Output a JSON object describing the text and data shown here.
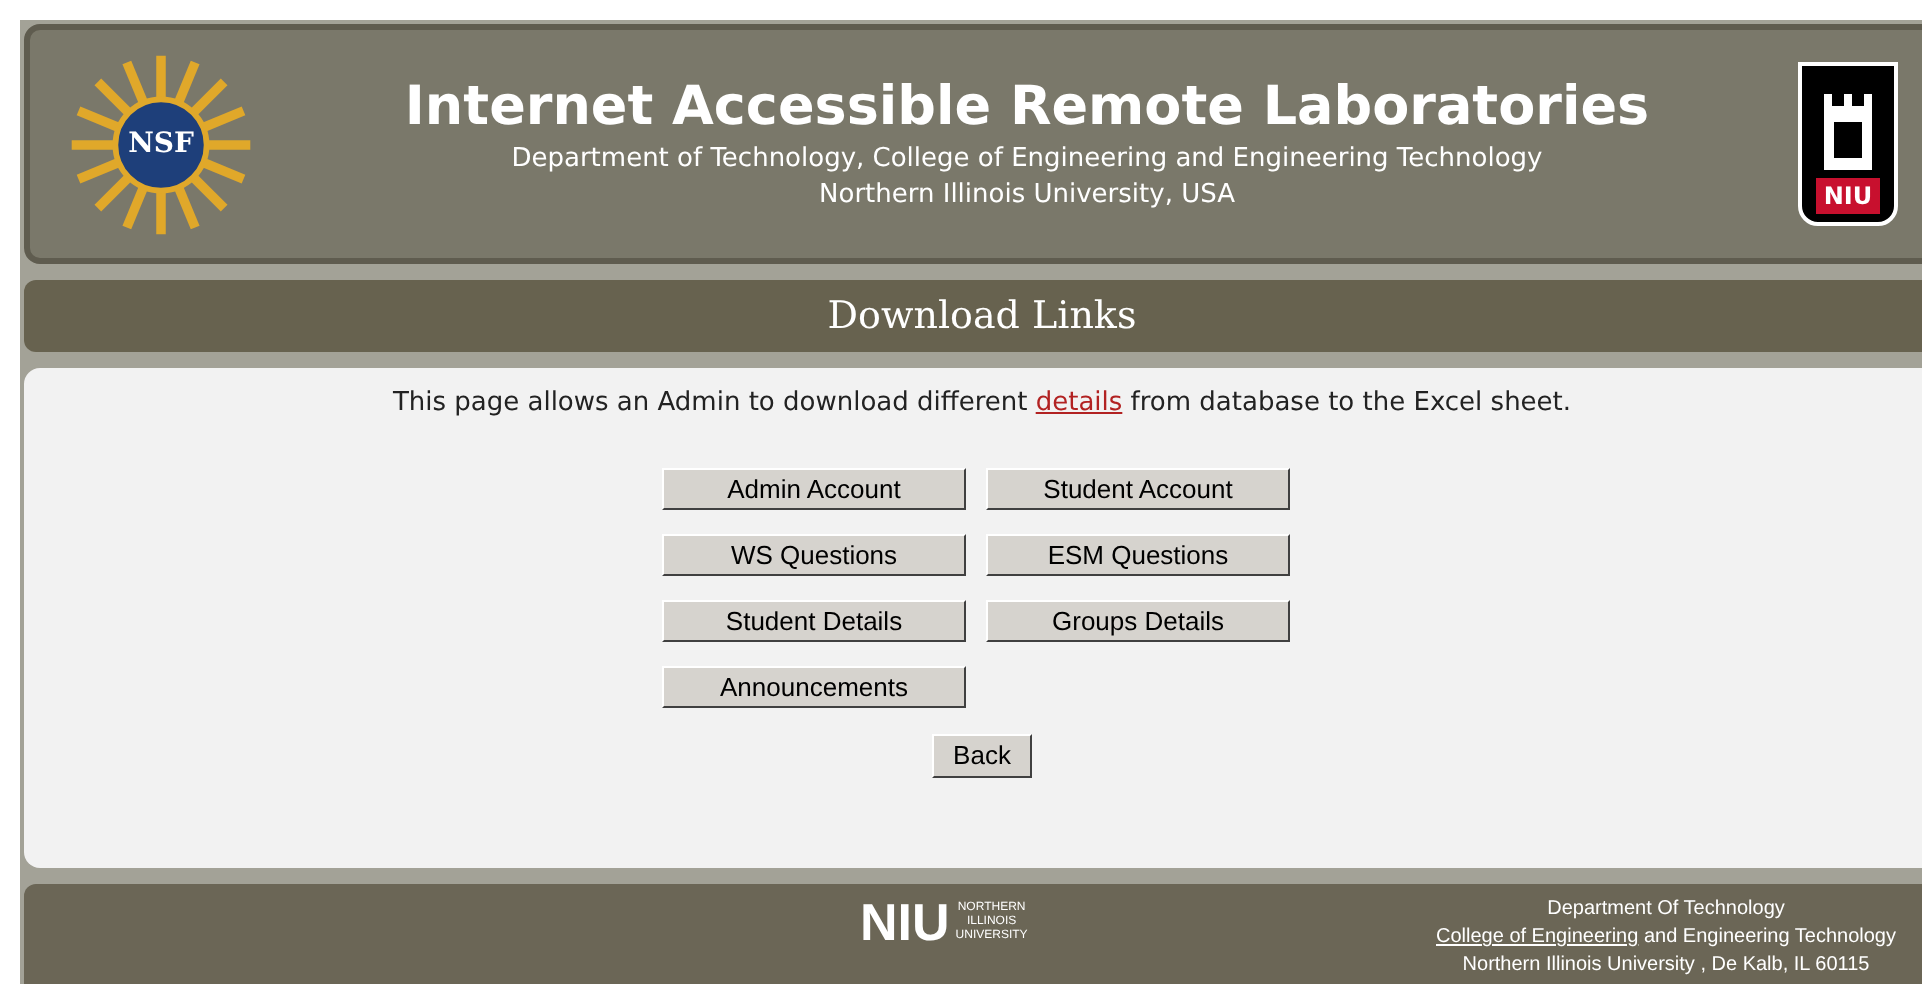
{
  "header": {
    "logo_left": "NSF",
    "title": "Internet Accessible Remote Laboratories",
    "subtitle_1": "Department of Technology, College of Engineering and Engineering Technology",
    "subtitle_2": "Northern Illinois University, USA",
    "logo_right": "NIU"
  },
  "page_title": "Download Links",
  "intro": {
    "before": "This page allows an Admin to download different ",
    "link": "details",
    "after": " from database to the Excel sheet."
  },
  "buttons": [
    "Admin Account",
    "Student Account",
    "WS Questions",
    "ESM Questions",
    "Student Details",
    "Groups Details",
    "Announcements"
  ],
  "back_button": "Back",
  "footer": {
    "logo_mark": "NIU",
    "logo_lines": [
      "NORTHERN",
      "ILLINOIS",
      "UNIVERSITY"
    ],
    "line_1": "Department Of Technology",
    "link": "College of Engineering",
    "line_2_rest": " and Engineering Technology",
    "line_3": "Northern Illinois University , De Kalb, IL 60115"
  }
}
